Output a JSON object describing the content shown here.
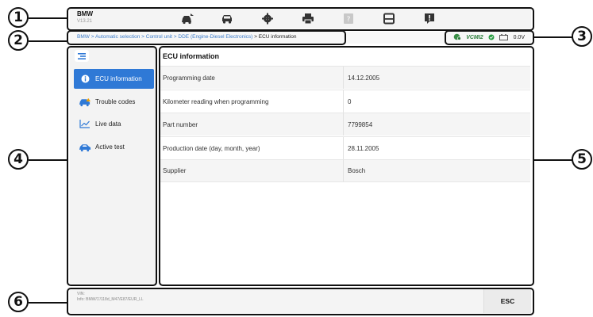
{
  "header": {
    "brand": "BMW",
    "version": "V13.21",
    "icons": [
      "home-vehicle-icon",
      "car-icon",
      "gear-icon",
      "printer-icon",
      "help-icon",
      "save-icon",
      "feedback-icon"
    ]
  },
  "breadcrumb": {
    "items": [
      "BMW",
      "Automatic selection",
      "Control unit",
      "DDE (Engine-Diesel Electronics)"
    ],
    "current": "ECU information",
    "separator": " > "
  },
  "status": {
    "vci_label": "VCMI2",
    "voltage": "0.0V"
  },
  "sidebar": {
    "items": [
      {
        "label": "ECU information",
        "icon": "info-icon",
        "active": true
      },
      {
        "label": "Trouble codes",
        "icon": "car-fault-icon",
        "active": false
      },
      {
        "label": "Live data",
        "icon": "chart-line-icon",
        "active": false
      },
      {
        "label": "Active test",
        "icon": "car-test-icon",
        "active": false
      }
    ]
  },
  "panel": {
    "title": "ECU information",
    "rows": [
      {
        "label": "Programming date",
        "value": "14.12.2005"
      },
      {
        "label": "Kilometer reading when programming",
        "value": "0"
      },
      {
        "label": "Part number",
        "value": "7799854"
      },
      {
        "label": "Production date (day, month, year)",
        "value": "28.11.2005"
      },
      {
        "label": "Supplier",
        "value": "Bosch"
      }
    ]
  },
  "footer": {
    "vin_label": "VIN:",
    "info": "Info: BMW/1'/118d_M47/E87/EUR_LL",
    "esc_label": "ESC"
  },
  "callouts": [
    "1",
    "2",
    "3",
    "4",
    "5",
    "6"
  ],
  "colors": {
    "accent": "#2f79d6",
    "link": "#3d7cc9",
    "status_green": "#2a7d3a"
  }
}
